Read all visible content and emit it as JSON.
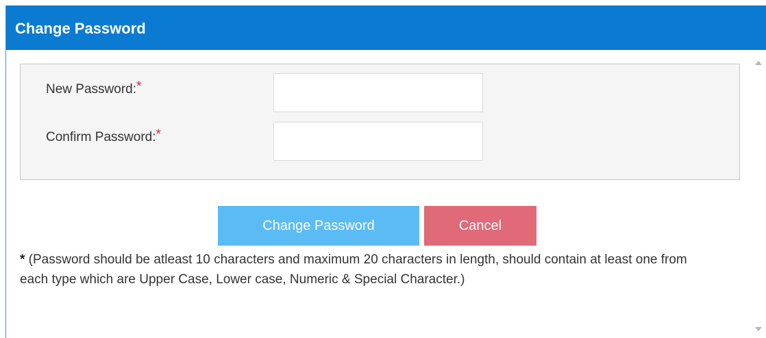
{
  "dialog": {
    "title": "Change Password"
  },
  "form": {
    "new_password": {
      "label": "New Password:",
      "required_mark": "*",
      "value": ""
    },
    "confirm_password": {
      "label": "Confirm Password:",
      "required_mark": "*",
      "value": ""
    }
  },
  "actions": {
    "change_label": "Change Password",
    "cancel_label": "Cancel"
  },
  "note": {
    "star": "*",
    "text": " (Password should be atleast 10 characters and maximum 20 characters in length, should contain at least one from each type which are Upper Case, Lower case, Numeric & Special Character.)"
  },
  "colors": {
    "titlebar": "#0a7bd1",
    "change_button": "#5bbcf5",
    "cancel_button": "#e06a78",
    "required": "#e0202a"
  },
  "icons": {
    "scroll_up": "scroll-up-arrow-icon",
    "scroll_down": "scroll-down-arrow-icon"
  }
}
